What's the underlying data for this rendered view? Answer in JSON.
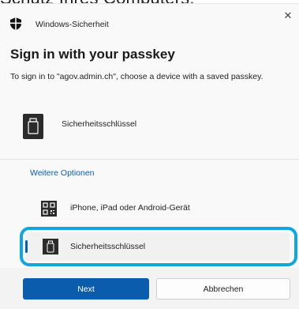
{
  "background": {
    "text": "Schutz Ihres Computers."
  },
  "dialog": {
    "app_title": "Windows-Sicherheit",
    "close_icon": "close-icon",
    "heading": "Sign in with your passkey",
    "description": "To sign in to \"agov.admin.ch\", choose a device with a saved passkey.",
    "primary_device": {
      "label": "Sicherheitsschlüssel",
      "icon": "usb-key-icon"
    },
    "more_options_label": "Weitere Optionen",
    "options": [
      {
        "label": "iPhone, iPad oder Android-Gerät",
        "icon": "qr-code-icon",
        "selected": false
      },
      {
        "label": "Sicherheitsschlüssel",
        "icon": "usb-key-icon",
        "selected": true
      }
    ],
    "buttons": {
      "next": "Next",
      "cancel": "Abbrechen"
    }
  },
  "colors": {
    "accent": "#0b5cad",
    "highlight": "#13a6dc",
    "link": "#0a5ea8"
  }
}
